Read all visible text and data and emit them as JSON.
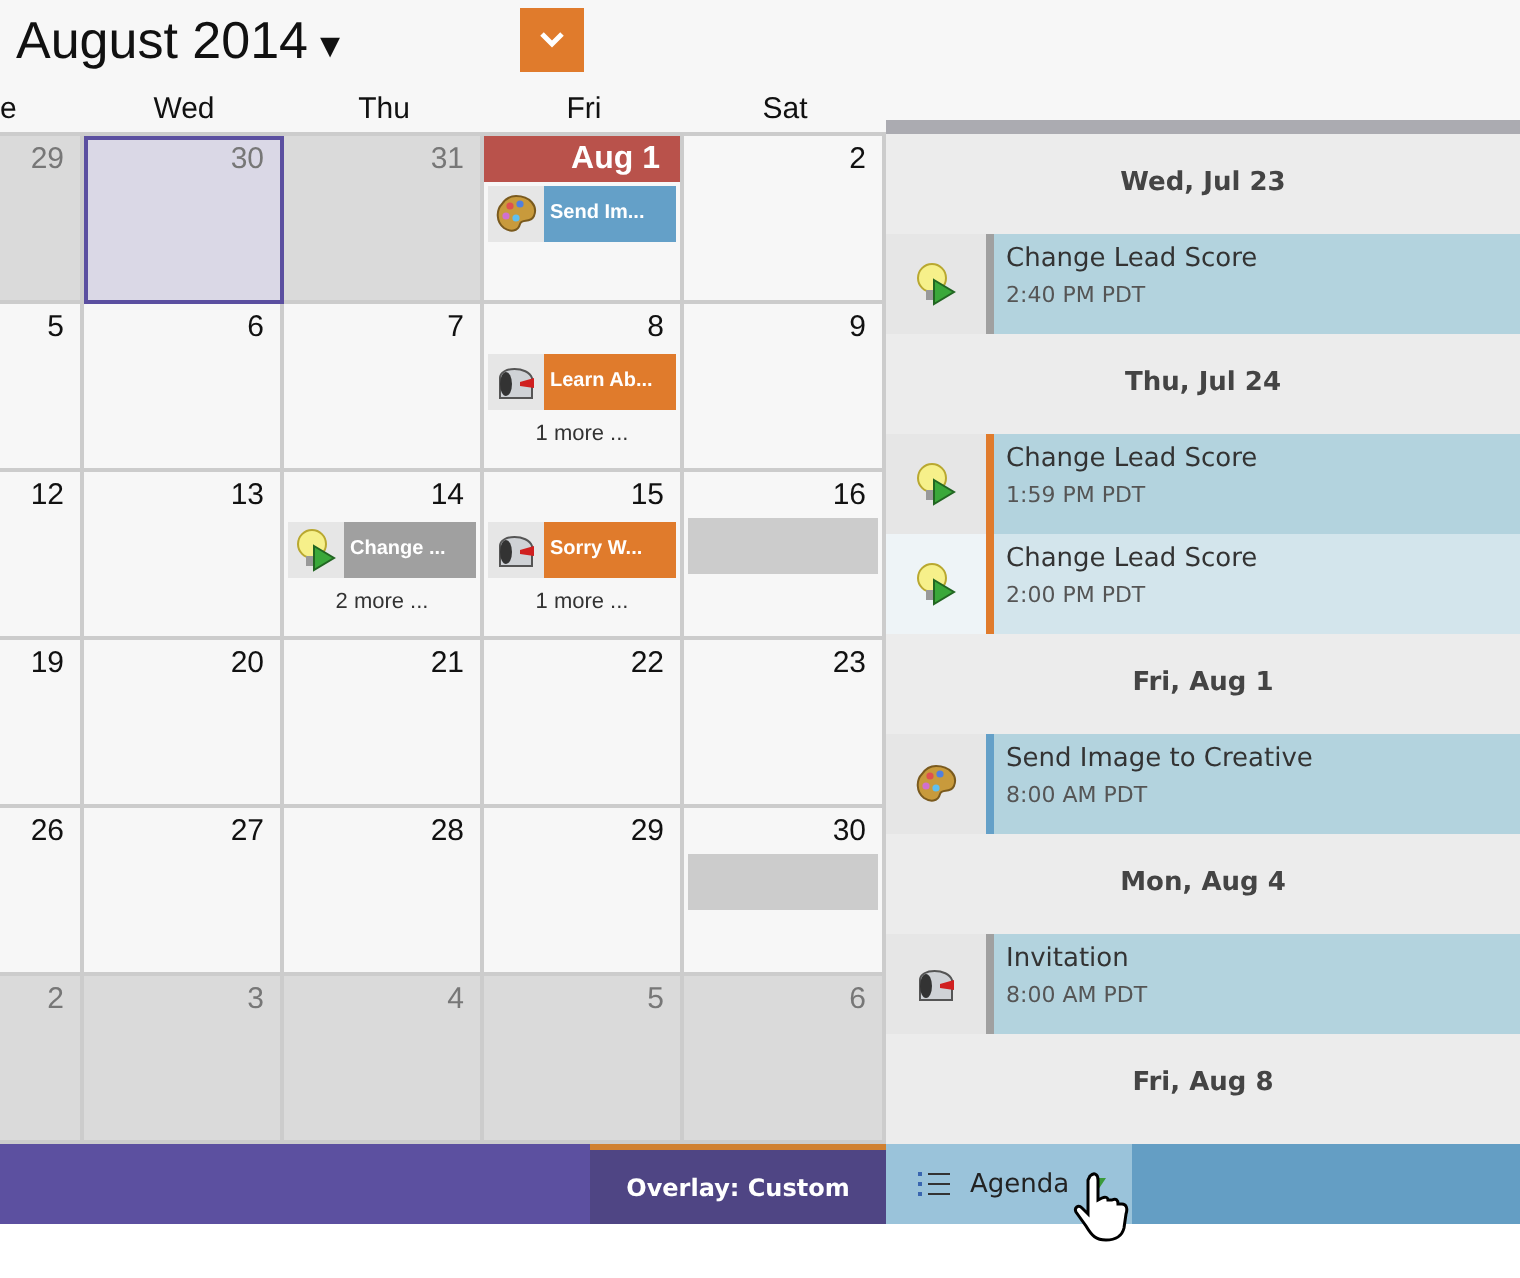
{
  "header": {
    "month": "August 2014",
    "month_caret": "▾"
  },
  "weekdays": [
    "e",
    "Wed",
    "Thu",
    "Fri",
    "Sat"
  ],
  "weeks": [
    {
      "days": [
        {
          "day": "29",
          "kind": "other",
          "selected": false,
          "today": false
        },
        {
          "day": "30",
          "kind": "other",
          "selected": true,
          "today": false
        },
        {
          "day": "31",
          "kind": "other",
          "selected": false,
          "today": false
        },
        {
          "day": "Aug 1",
          "kind": "current",
          "selected": false,
          "today": true,
          "events": [
            {
              "kind": "creative",
              "title": "Send Im...",
              "color": "#64a0c8"
            }
          ]
        },
        {
          "day": "2",
          "kind": "current",
          "selected": false,
          "today": false
        }
      ]
    },
    {
      "days": [
        {
          "day": "5",
          "kind": "current",
          "selected": false,
          "today": false
        },
        {
          "day": "6",
          "kind": "current",
          "selected": false,
          "today": false
        },
        {
          "day": "7",
          "kind": "current",
          "selected": false,
          "today": false
        },
        {
          "day": "8",
          "kind": "current",
          "selected": false,
          "today": false,
          "events": [
            {
              "kind": "email",
              "title": "Learn Ab...",
              "color": "#e07b2c"
            }
          ],
          "more": "1 more ..."
        },
        {
          "day": "9",
          "kind": "current",
          "selected": false,
          "today": false
        }
      ]
    },
    {
      "days": [
        {
          "day": "12",
          "kind": "current",
          "selected": false,
          "today": false
        },
        {
          "day": "13",
          "kind": "current",
          "selected": false,
          "today": false
        },
        {
          "day": "14",
          "kind": "current",
          "selected": false,
          "today": false,
          "events": [
            {
              "kind": "score",
              "title": "Change ...",
              "color": "#a0a0a0"
            }
          ],
          "more": "2 more ..."
        },
        {
          "day": "15",
          "kind": "current",
          "selected": false,
          "today": false,
          "events": [
            {
              "kind": "email",
              "title": "Sorry W...",
              "color": "#e07b2c"
            }
          ],
          "more": "1 more ..."
        },
        {
          "day": "16",
          "kind": "current",
          "selected": false,
          "today": false,
          "events": [
            {
              "kind": "blank",
              "color": "#cccccc"
            }
          ]
        }
      ]
    },
    {
      "days": [
        {
          "day": "19",
          "kind": "current",
          "selected": false,
          "today": false
        },
        {
          "day": "20",
          "kind": "current",
          "selected": false,
          "today": false
        },
        {
          "day": "21",
          "kind": "current",
          "selected": false,
          "today": false
        },
        {
          "day": "22",
          "kind": "current",
          "selected": false,
          "today": false
        },
        {
          "day": "23",
          "kind": "current",
          "selected": false,
          "today": false
        }
      ]
    },
    {
      "days": [
        {
          "day": "26",
          "kind": "current",
          "selected": false,
          "today": false
        },
        {
          "day": "27",
          "kind": "current",
          "selected": false,
          "today": false
        },
        {
          "day": "28",
          "kind": "current",
          "selected": false,
          "today": false
        },
        {
          "day": "29",
          "kind": "current",
          "selected": false,
          "today": false
        },
        {
          "day": "30",
          "kind": "current",
          "selected": false,
          "today": false,
          "events": [
            {
              "kind": "blank",
              "color": "#cccccc"
            }
          ]
        }
      ]
    },
    {
      "days": [
        {
          "day": "2",
          "kind": "other",
          "selected": false,
          "today": false
        },
        {
          "day": "3",
          "kind": "other",
          "selected": false,
          "today": false
        },
        {
          "day": "4",
          "kind": "other",
          "selected": false,
          "today": false
        },
        {
          "day": "5",
          "kind": "other",
          "selected": false,
          "today": false
        },
        {
          "day": "6",
          "kind": "other",
          "selected": false,
          "today": false
        }
      ]
    }
  ],
  "agenda": [
    {
      "date": "Wed, Jul 23",
      "items": [
        {
          "kind": "score",
          "title": "Change Lead Score",
          "time": "2:40 PM PDT",
          "color": "#a0a0a0",
          "selected": false
        }
      ]
    },
    {
      "date": "Thu, Jul 24",
      "items": [
        {
          "kind": "score",
          "title": "Change Lead Score",
          "time": "1:59 PM PDT",
          "color": "#e07b2c",
          "selected": false
        },
        {
          "kind": "score",
          "title": "Change Lead Score",
          "time": "2:00 PM PDT",
          "color": "#e07b2c",
          "selected": true
        }
      ]
    },
    {
      "date": "Fri, Aug 1",
      "items": [
        {
          "kind": "creative",
          "title": "Send Image to Creative",
          "time": "8:00 AM PDT",
          "color": "#64a0c8",
          "selected": false
        }
      ]
    },
    {
      "date": "Mon, Aug 4",
      "items": [
        {
          "kind": "email",
          "title": "Invitation",
          "time": "8:00 AM PDT",
          "color": "#a0a0a0",
          "selected": false
        }
      ]
    },
    {
      "date": "Fri, Aug 8"
    }
  ],
  "bottom_bar": {
    "tabs": [
      {
        "label": "Overlay: Custom",
        "kind": "overlay",
        "selected": true
      },
      {
        "label": "Agenda",
        "kind": "view",
        "selected": false
      }
    ]
  }
}
